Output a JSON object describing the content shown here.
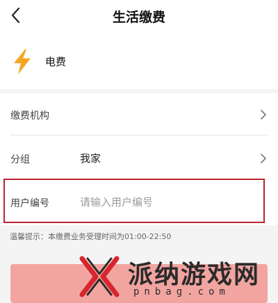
{
  "header": {
    "title": "生活缴费"
  },
  "service": {
    "name": "电费",
    "icon": "lightning-bolt-icon",
    "icon_color": "#f5a623"
  },
  "form": {
    "institution_label": "缴费机构",
    "group_label": "分组",
    "group_value": "我家",
    "user_id_label": "用户编号",
    "user_id_placeholder": "请输入用户编号",
    "user_id_value": ""
  },
  "hint": "温馨提示：本缴费业务受理时间为01:00-22:50",
  "watermark": {
    "text": "派纳游戏网",
    "domain": "pnbag.com"
  },
  "colors": {
    "highlight_border": "#b8232f",
    "submit_button": "#f2a5a0"
  }
}
